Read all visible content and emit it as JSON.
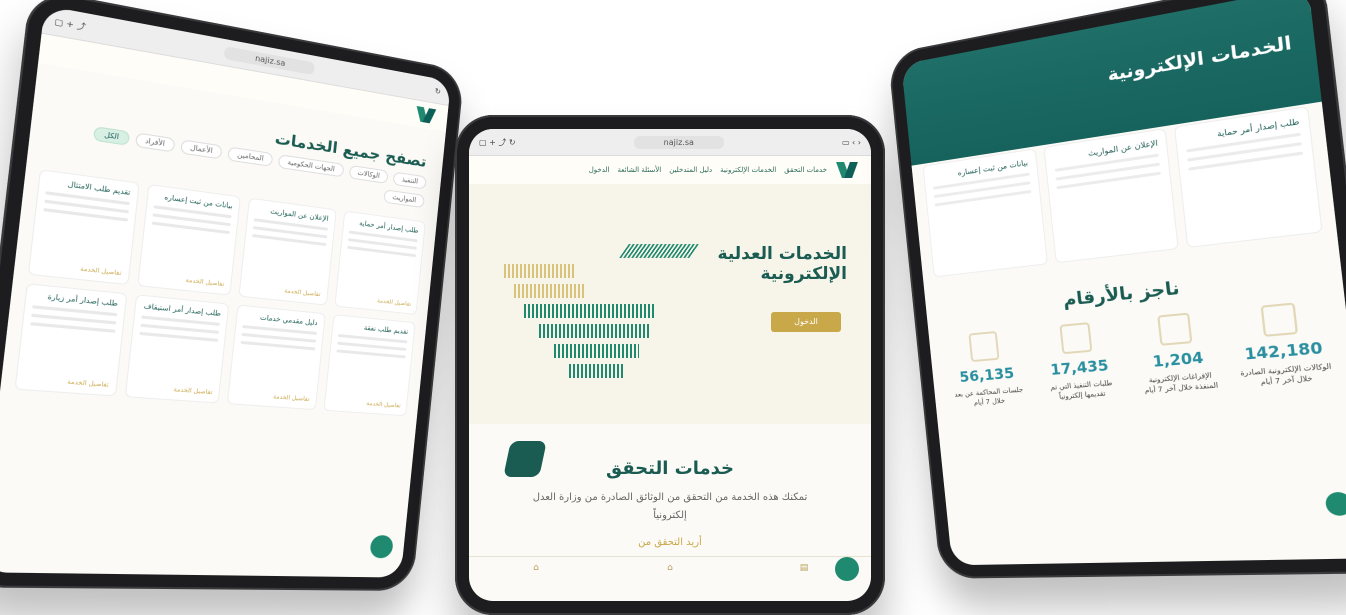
{
  "middle": {
    "browser": {
      "url": "najiz.sa"
    },
    "nav": {
      "items": [
        "خدمات التحقق",
        "الخدمات الإلكترونية",
        "دليل المتدخلين",
        "الأسئلة الشائعة",
        "الدخول"
      ]
    },
    "hero": {
      "title": "الخدمات العدلية الإلكترونية",
      "button": "الدخول"
    },
    "verification": {
      "title": "خدمات التحقق",
      "description": "تمكنك هذه الخدمة من التحقق من الوثائق الصادرة من وزارة العدل إلكترونياً",
      "link": "أريد التحقق من"
    },
    "bottom_tabs": [
      "",
      "",
      ""
    ]
  },
  "left": {
    "browser": {
      "url": "najiz.sa"
    },
    "title": "تصفح جميع الخدمات",
    "chips": [
      "الكل",
      "الأفراد",
      "الأعمال",
      "المحامين",
      "الجهات الحكومية",
      "الوكالات",
      "التنفيذ",
      "المواريث"
    ],
    "cards": [
      {
        "title": "طلب إصدار أمر حماية",
        "more": "تفاصيل الخدمة"
      },
      {
        "title": "الإعلان عن المواريث",
        "more": "تفاصيل الخدمة"
      },
      {
        "title": "بيانات من ثبت إعساره",
        "more": "تفاصيل الخدمة"
      },
      {
        "title": "تقديم طلب الامتثال",
        "more": "تفاصيل الخدمة"
      },
      {
        "title": "تقديم طلب نفقة",
        "more": "تفاصيل الخدمة"
      },
      {
        "title": "دليل مقدمي خدمات",
        "more": "تفاصيل الخدمة"
      },
      {
        "title": "طلب إصدار أمر استيقاف",
        "more": "تفاصيل الخدمة"
      },
      {
        "title": "طلب إصدار أمر زيارة",
        "more": "تفاصيل الخدمة"
      }
    ]
  },
  "right": {
    "title": "الخدمات الإلكترونية",
    "cards": [
      {
        "title": "طلب إصدار أمر حماية"
      },
      {
        "title": "الإعلان عن المواريث"
      },
      {
        "title": "بيانات من ثبت إعساره"
      }
    ],
    "numbers_title": "ناجز بالأرقام",
    "stats": [
      {
        "value": "142,180",
        "label": "الوكالات الإلكترونية الصادرة خلال آخر 7 أيام"
      },
      {
        "value": "1,204",
        "label": "الإفراغات الإلكترونية المنفذة خلال آخر 7 أيام"
      },
      {
        "value": "17,435",
        "label": "طلبات التنفيذ التي تم تقديمها إلكترونياً"
      },
      {
        "value": "56,135",
        "label": "جلسات المحاكمة عن بعد خلال 7 أيام"
      }
    ]
  }
}
